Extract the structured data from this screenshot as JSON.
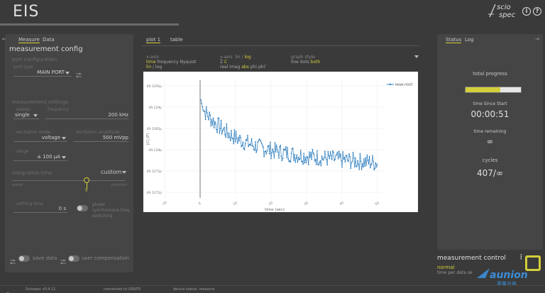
{
  "header": {
    "title": "EIS",
    "logo_top": "scio",
    "logo_bottom": "spec",
    "info_glyph": "i",
    "help_glyph": "?"
  },
  "left_panel": {
    "collapse_glyph": "⇤",
    "tabs": [
      {
        "label": "Measure"
      },
      {
        "label": "Data"
      }
    ],
    "title": "measurement config",
    "port_config": {
      "heading": "port configuration",
      "port_type_label": "port type",
      "port_type_value": "MAIN PORT"
    },
    "settings": {
      "heading": "measurement settings",
      "sweep_label": "sweep",
      "sweep_value": "single",
      "frequency_label": "frequency",
      "frequency_value": "200 kHz",
      "excitation_mode_label": "excitation mode",
      "excitation_mode_value": "voltage",
      "excitation_amplitude_label": "excitation amplitude",
      "excitation_amplitude_value": "500 mVpp",
      "range_label": "range",
      "range_value": "± 100 µA",
      "integration_time_label": "integration time",
      "integration_time_value": "custom",
      "slider_left": "speed",
      "slider_right": "precision",
      "slider_value": "5",
      "settling_time_label": "settling time",
      "settling_time_value": "0 s",
      "phase_sync_label": "phase synchronous freq. switching"
    },
    "save_data_label": "save data",
    "user_comp_label": "user compensation"
  },
  "center": {
    "tabs": [
      {
        "label": "plot 1"
      },
      {
        "label": "table"
      }
    ],
    "xaxis": {
      "label": "x-axis",
      "options": [
        "time",
        "frequency",
        "Nyquist"
      ],
      "scale": [
        "lin",
        "/",
        "log"
      ]
    },
    "yaxis": {
      "label": "y-axis",
      "scale_label": "lin",
      "scale_sep": "/",
      "scale_active": "log",
      "options_z": "Z",
      "options_c": "C",
      "options_extra": [
        "real",
        "imag",
        "abs",
        "phi",
        "phi'"
      ]
    },
    "graph_style": {
      "label": "graph style",
      "options": [
        "line",
        "dots",
        "both"
      ]
    }
  },
  "chart_data": {
    "type": "line",
    "series": [
      {
        "name": "MAIN PORT"
      }
    ],
    "xlabel": "time (sec)",
    "ylabel": "|C| (F)",
    "xticks": [
      "-10",
      "0",
      "10",
      "20",
      "30",
      "40",
      "50"
    ],
    "yticks": [
      "49.1275p",
      "49.1275p",
      "49.128p",
      "49.1285p",
      "49.129p",
      "49.1295p"
    ],
    "xlim": [
      -10,
      52
    ],
    "grid": true,
    "legend": "top-right",
    "color": "#2f7fbf"
  },
  "right_panel": {
    "tabs": [
      {
        "label": "Status"
      },
      {
        "label": "Log"
      }
    ],
    "collapse_glyph": "⇥",
    "total_progress_label": "total progress",
    "progress": 0.63,
    "time_since_label": "time Since Start",
    "time_since_value": "00:00:51",
    "time_remaining_label": "time remaining",
    "time_remaining_value": "∞",
    "cycles_label": "cycles",
    "cycles_value": "407/∞"
  },
  "measurement_control": {
    "title": "measurement control",
    "mode": "normal",
    "time_per_point_label": "time per data se"
  },
  "status_bar": {
    "version": "Sciospec v0.4.11",
    "connection": "connected to USB/FS",
    "device_status": "device status: measure"
  },
  "watermark": {
    "text": "aunion",
    "sub": "昊量光电"
  }
}
